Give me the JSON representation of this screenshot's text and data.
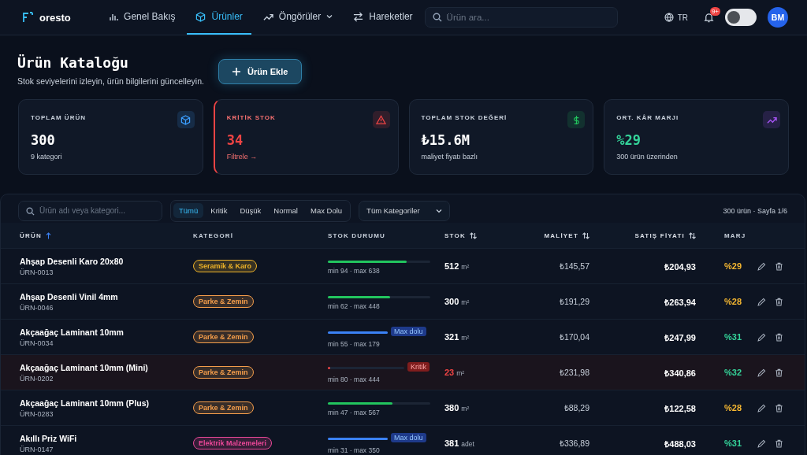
{
  "nav": {
    "logo": "oresto",
    "items": [
      {
        "label": "Genel Bakış",
        "selected": false,
        "dropdown": false
      },
      {
        "label": "Ürünler",
        "selected": true,
        "dropdown": false
      },
      {
        "label": "Öngörüler",
        "selected": false,
        "dropdown": true
      },
      {
        "label": "Hareketler",
        "selected": false,
        "dropdown": false
      }
    ],
    "search": {
      "placeholder": "Ürün ara..."
    },
    "language": "TR",
    "notification_badge": "9+",
    "theme_toggle": {
      "on": false
    },
    "avatar": "BM"
  },
  "header": {
    "title": "Ürün Kataloğu",
    "subtitle": "Stok seviyelerini izleyin, ürün bilgilerini güncelleyin.",
    "add_button": "Ürün Ekle"
  },
  "stats": [
    {
      "title": "TOPLAM ÜRÜN",
      "value": "300",
      "note": "9 kategori",
      "kind": "cube",
      "alert": false,
      "color": "#3b9eff"
    },
    {
      "title": "KRİTİK STOK",
      "value": "34",
      "note": "Filtrele →",
      "kind": "warning",
      "alert": true,
      "color": "#ef4444"
    },
    {
      "title": "TOPLAM STOK DEĞERİ",
      "value": "₺15.6M",
      "note": "maliyet fiyatı bazlı",
      "kind": "dollar",
      "alert": false,
      "color": "#22c55e"
    },
    {
      "title": "ORT. KÂR MARJI",
      "value": "%29",
      "note": "300 ürün üzerinden",
      "kind": "trend",
      "alert": false,
      "color": "#a855f7"
    }
  ],
  "filters": {
    "search_placeholder": "Ürün adı veya kategori...",
    "tabs": [
      {
        "label": "Tümü",
        "selected": true
      },
      {
        "label": "Kritik",
        "selected": false
      },
      {
        "label": "Düşük",
        "selected": false
      },
      {
        "label": "Normal",
        "selected": false
      },
      {
        "label": "Max Dolu",
        "selected": false
      }
    ],
    "category_select": "Tüm Kategoriler",
    "summary": "300 ürün · Sayfa 1/6"
  },
  "table": {
    "columns": [
      {
        "label": "ÜRÜN",
        "sorted": true,
        "sortable": true
      },
      {
        "label": "KATEGORİ",
        "sorted": false,
        "sortable": false
      },
      {
        "label": "STOK DURUMU",
        "sorted": false,
        "sortable": false
      },
      {
        "label": "STOK",
        "sorted": false,
        "sortable": true
      },
      {
        "label": "MALİYET",
        "sorted": false,
        "sortable": true
      },
      {
        "label": "SATIŞ FİYATI",
        "sorted": false,
        "sortable": true
      },
      {
        "label": "MARJ",
        "sorted": false,
        "sortable": false
      }
    ],
    "rows": [
      {
        "name": "Ahşap Desenli Karo 20x80",
        "code": "ÜRN-0013",
        "category": {
          "label": "Seramik & Karo",
          "color": "#f0b429"
        },
        "status": {
          "kind": "normal",
          "level": 0.77,
          "range": "min 94 · max 638"
        },
        "stock": "512",
        "unit": "m²",
        "cost": "₺145,57",
        "price": "₺204,93",
        "margin": {
          "text": "%29",
          "color": "#f5b731"
        }
      },
      {
        "name": "Ahşap Desenli Vinil 4mm",
        "code": "ÜRN-0046",
        "category": {
          "label": "Parke & Zemin",
          "color": "#f59e4b"
        },
        "status": {
          "kind": "normal",
          "level": 0.61,
          "range": "min 62 · max 448"
        },
        "stock": "300",
        "unit": "m²",
        "cost": "₺191,29",
        "price": "₺263,94",
        "margin": {
          "text": "%28",
          "color": "#f5b731"
        }
      },
      {
        "name": "Akçaağaç Laminant 10mm",
        "code": "ÜRN-0034",
        "category": {
          "label": "Parke & Zemin",
          "color": "#f59e4b"
        },
        "status": {
          "kind": "max",
          "level": 1,
          "range": "min 55 · max 179",
          "badge": "Max dolu"
        },
        "stock": "321",
        "unit": "m²",
        "cost": "₺170,04",
        "price": "₺247,99",
        "margin": {
          "text": "%31",
          "color": "#34d399"
        }
      },
      {
        "name": "Akçaağaç Laminant 10mm (Mini)",
        "code": "ÜRN-0202",
        "category": {
          "label": "Parke & Zemin",
          "color": "#f59e4b"
        },
        "status": {
          "kind": "critical",
          "level": 0.03,
          "range": "min 80 · max 444",
          "badge": "Kritik"
        },
        "stock": "23",
        "unit": "m²",
        "cost": "₺231,98",
        "price": "₺340,86",
        "margin": {
          "text": "%32",
          "color": "#34d399"
        }
      },
      {
        "name": "Akçaağaç Laminant 10mm (Plus)",
        "code": "ÜRN-0283",
        "category": {
          "label": "Parke & Zemin",
          "color": "#f59e4b"
        },
        "status": {
          "kind": "normal",
          "level": 0.63,
          "range": "min 47 · max 567"
        },
        "stock": "380",
        "unit": "m²",
        "cost": "₺88,29",
        "price": "₺122,58",
        "margin": {
          "text": "%28",
          "color": "#f5b731"
        }
      },
      {
        "name": "Akıllı Priz WiFi",
        "code": "ÜRN-0147",
        "category": {
          "label": "Elektrik Malzemeleri",
          "color": "#ec4899"
        },
        "status": {
          "kind": "max",
          "level": 1,
          "range": "min 31 · max 350",
          "badge": "Max dolu"
        },
        "stock": "381",
        "unit": "adet",
        "cost": "₺336,89",
        "price": "₺488,03",
        "margin": {
          "text": "%31",
          "color": "#34d399"
        }
      }
    ]
  }
}
